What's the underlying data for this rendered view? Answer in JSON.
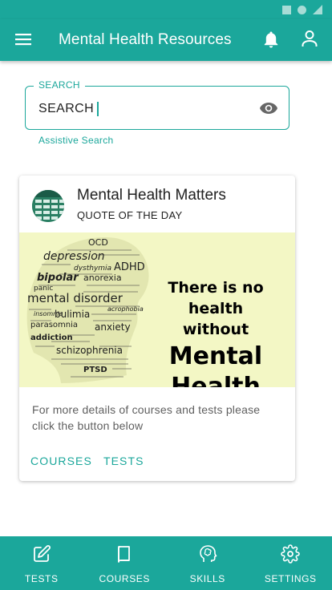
{
  "app_bar": {
    "title": "Mental Health Resources",
    "menu_icon": "menu-icon",
    "bell_icon": "bell-icon",
    "user_icon": "user-icon"
  },
  "search": {
    "label": "SEARCH",
    "value": "SEARCH",
    "helper": "Assistive Search",
    "trailing_icon": "eye-icon"
  },
  "card": {
    "title": "Mental Health Matters",
    "subtitle": "QUOTE OF THE DAY",
    "quote": {
      "line1": "There is no health",
      "line2": "without",
      "line3": "Mental Health"
    },
    "words": [
      "OCD",
      "depression",
      "dysthymia",
      "ADHD",
      "bipolar",
      "anorexia",
      "mental disorder",
      "bulimia",
      "anxiety",
      "addiction",
      "parasomnia",
      "panic",
      "schizophrenia",
      "PTSD",
      "acrophobia",
      "insomnia"
    ],
    "body": "For more details of courses and tests please click the button below",
    "actions": {
      "courses": "COURSES",
      "tests": "TESTS"
    }
  },
  "bottom_nav": [
    {
      "label": "TESTS",
      "icon": "edit-icon"
    },
    {
      "label": "COURSES",
      "icon": "book-icon"
    },
    {
      "label": "SKILLS",
      "icon": "brain-icon"
    },
    {
      "label": "SETTINGS",
      "icon": "gear-icon"
    }
  ],
  "colors": {
    "primary": "#1ba79b",
    "media_bg": "#f3f7c5",
    "text": "#212121"
  }
}
